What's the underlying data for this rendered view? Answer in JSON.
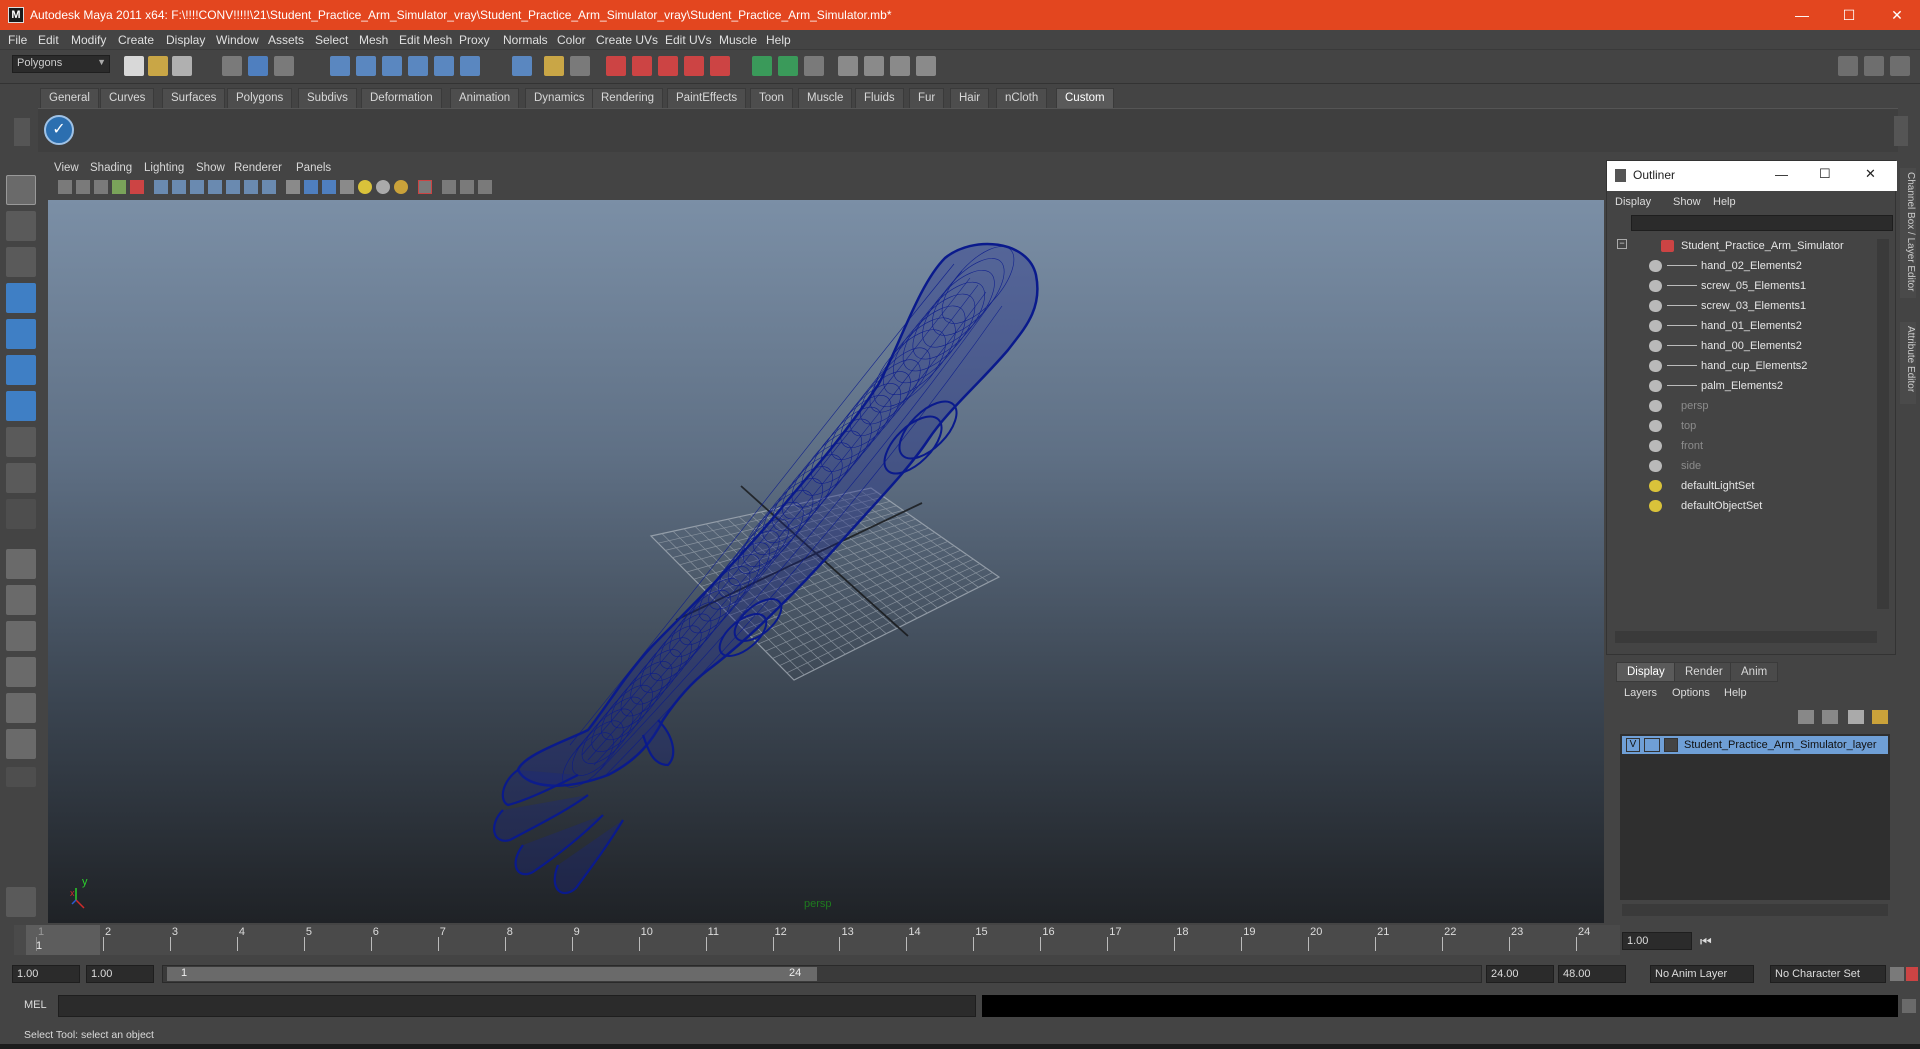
{
  "window": {
    "title": "Autodesk Maya 2011 x64: F:\\!!!!CONV!!!!!\\21\\Student_Practice_Arm_Simulator_vray\\Student_Practice_Arm_Simulator_vray\\Student_Practice_Arm_Simulator.mb*",
    "app_icon": "M",
    "minimize": "—",
    "maximize": "☐",
    "close": "✕"
  },
  "menubar": [
    "File",
    "Edit",
    "Modify",
    "Create",
    "Display",
    "Window",
    "Assets",
    "Select",
    "Mesh",
    "Edit Mesh",
    "Proxy",
    "Normals",
    "Color",
    "Create UVs",
    "Edit UVs",
    "Muscle",
    "Help"
  ],
  "statusline": {
    "menuset": "Polygons"
  },
  "shelf": {
    "tabs": [
      "General",
      "Curves",
      "Surfaces",
      "Polygons",
      "Subdivs",
      "Deformation",
      "Animation",
      "Dynamics",
      "Rendering",
      "PaintEffects",
      "Toon",
      "Muscle",
      "Fluids",
      "Fur",
      "Hair",
      "nCloth",
      "Custom"
    ],
    "active_tab": "Custom"
  },
  "panel": {
    "menus": [
      "View",
      "Shading",
      "Lighting",
      "Show",
      "Renderer",
      "Panels"
    ],
    "camera_label": "persp",
    "axis_y": "y",
    "axis_x": "x"
  },
  "outliner": {
    "title": "Outliner",
    "menus": [
      "Display",
      "Show",
      "Help"
    ],
    "items": [
      {
        "label": "Student_Practice_Arm_Simulator",
        "level": 0,
        "dim": false,
        "kind": "group"
      },
      {
        "label": "hand_02_Elements2",
        "level": 1,
        "dim": false,
        "kind": "mesh"
      },
      {
        "label": "screw_05_Elements1",
        "level": 1,
        "dim": false,
        "kind": "mesh"
      },
      {
        "label": "screw_03_Elements1",
        "level": 1,
        "dim": false,
        "kind": "mesh"
      },
      {
        "label": "hand_01_Elements2",
        "level": 1,
        "dim": false,
        "kind": "mesh"
      },
      {
        "label": "hand_00_Elements2",
        "level": 1,
        "dim": false,
        "kind": "mesh"
      },
      {
        "label": "hand_cup_Elements2",
        "level": 1,
        "dim": false,
        "kind": "mesh"
      },
      {
        "label": "palm_Elements2",
        "level": 1,
        "dim": false,
        "kind": "mesh"
      },
      {
        "label": "persp",
        "level": 0,
        "dim": true,
        "kind": "camera"
      },
      {
        "label": "top",
        "level": 0,
        "dim": true,
        "kind": "camera"
      },
      {
        "label": "front",
        "level": 0,
        "dim": true,
        "kind": "camera"
      },
      {
        "label": "side",
        "level": 0,
        "dim": true,
        "kind": "camera"
      },
      {
        "label": "defaultLightSet",
        "level": 0,
        "dim": false,
        "kind": "set"
      },
      {
        "label": "defaultObjectSet",
        "level": 0,
        "dim": false,
        "kind": "set"
      }
    ]
  },
  "side_tabs": {
    "channel_box": "Channel Box / Layer Editor",
    "attribute_editor": "Attribute Editor"
  },
  "layer_editor": {
    "tabs": [
      "Display",
      "Render",
      "Anim"
    ],
    "active_tab": "Display",
    "menus": [
      "Layers",
      "Options",
      "Help"
    ],
    "layer": {
      "visible": "V",
      "name": "Student_Practice_Arm_Simulator_layer"
    }
  },
  "timeslider": {
    "ticks": [
      "1",
      "2",
      "3",
      "4",
      "5",
      "6",
      "7",
      "8",
      "9",
      "10",
      "11",
      "12",
      "13",
      "14",
      "15",
      "16",
      "17",
      "18",
      "19",
      "20",
      "21",
      "22",
      "23",
      "24"
    ],
    "current_frame": "1",
    "current_time_field": "1.00"
  },
  "range": {
    "start": "1.00",
    "playback_start": "1.00",
    "slider_start": "1",
    "slider_end": "24",
    "playback_end": "24.00",
    "end": "48.00",
    "anim_layer": "No Anim Layer",
    "character_set": "No Character Set"
  },
  "commandline": {
    "label": "MEL"
  },
  "helpline": {
    "text": "Select Tool: select an object"
  },
  "colors": {
    "titlebar": "#e3461f",
    "wireframe": "#0a1a8c",
    "selected_layer": "#6f9fd6"
  }
}
